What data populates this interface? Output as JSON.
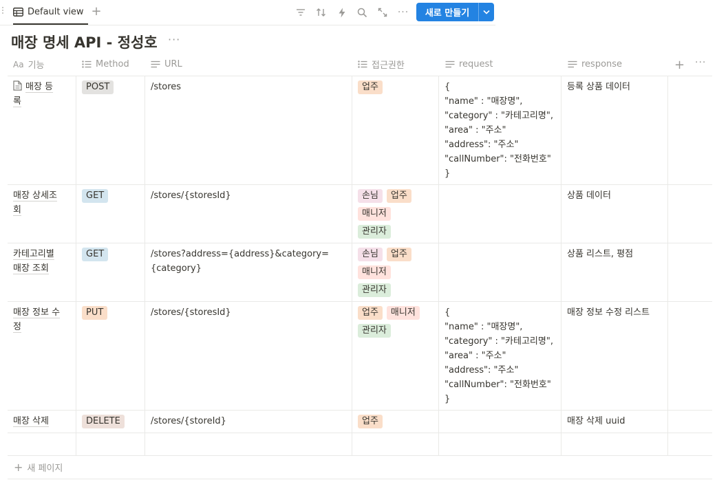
{
  "toolbar": {
    "view_label": "Default view",
    "add_view_glyph": "+",
    "new_button_label": "새로 만들기",
    "more_glyph": "···",
    "icons": [
      "filter-icon",
      "sort-icon",
      "lightning-icon",
      "search-icon",
      "expand-icon",
      "more-icon"
    ]
  },
  "page": {
    "title": "매장 명세 API - 정성호",
    "more_glyph": "···"
  },
  "columns": [
    {
      "label": "기능",
      "prefix": "Aa"
    },
    {
      "label": "Method"
    },
    {
      "label": "URL"
    },
    {
      "label": "접근권한"
    },
    {
      "label": "request"
    },
    {
      "label": "response"
    }
  ],
  "header_actions": {
    "add": "+",
    "more": "···"
  },
  "rows": [
    {
      "name_lines": [
        "매장 등",
        "록"
      ],
      "method": "POST",
      "url_lines": [
        "/stores"
      ],
      "access": [
        "업주"
      ],
      "request": "{\n\"name\" : \"매장명\",\n\"category\" : \"카테고리명\",\n\"area\" : \"주소\"\n\"address\": \"주소\"\n\"callNumber\": \"전화번호\"\n}",
      "response": "등록 상품 데이터"
    },
    {
      "name_lines": [
        "매장 상세조",
        "회"
      ],
      "method": "GET",
      "url_lines": [
        "/stores/{storesId}"
      ],
      "access": [
        "손님",
        "업주",
        "매니저",
        "관리자"
      ],
      "request": "",
      "response": "상품 데이터"
    },
    {
      "name_lines": [
        "카테고리별",
        "매장 조회"
      ],
      "method": "GET",
      "url_lines": [
        "/stores?address={address}&category=",
        "{category}"
      ],
      "access": [
        "손님",
        "업주",
        "매니저",
        "관리자"
      ],
      "request": "",
      "response": "상품 리스트, 평점"
    },
    {
      "name_lines": [
        "매장 정보 수",
        "정"
      ],
      "method": "PUT",
      "url_lines": [
        "/stores/{storesId}"
      ],
      "access": [
        "업주",
        "매니저",
        "관리자"
      ],
      "request": "{\n\"name\" : \"매장명\",\n\"category\" : \"카테고리명\",\n\"area\" : \"주소\"\n\"address\": \"주소\"\n\"callNumber\": \"전화번호\"\n}",
      "response": "매장 정보 수정 리스트"
    },
    {
      "name_lines": [
        "매장 삭제"
      ],
      "method": "DELETE",
      "url_lines": [
        "/stores/{storeId}"
      ],
      "access": [
        "업주"
      ],
      "request": "",
      "response": "매장 삭제 uuid"
    }
  ],
  "footer": {
    "new_page_glyph": "+",
    "new_page_label": "새 페이지"
  },
  "colors": {
    "accent": "#2383e2",
    "tag_POST": "#e3e2e0",
    "tag_GET": "#d3e5ef",
    "tag_PUT": "#fadec9",
    "tag_DELETE": "#eee0da",
    "tag_손님": "#f5e0e9",
    "tag_업주": "#fadec9",
    "tag_매니저": "#ffe2dd",
    "tag_관리자": "#dbeddb"
  }
}
